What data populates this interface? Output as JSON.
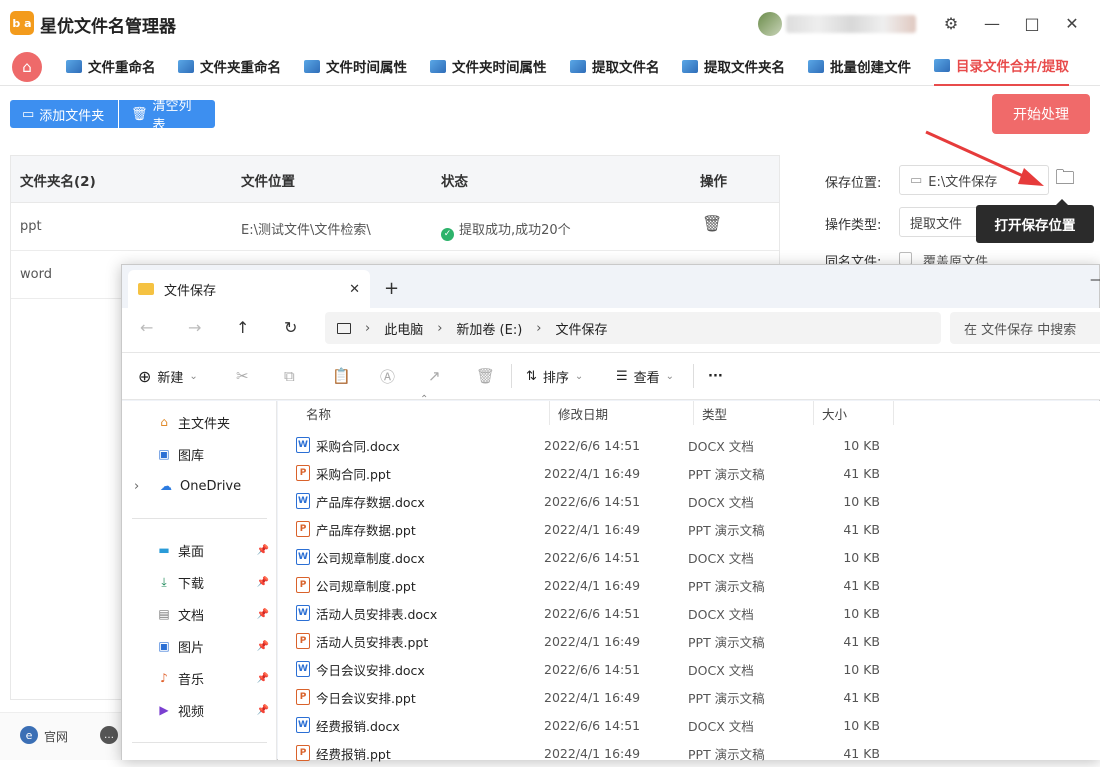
{
  "app": {
    "title": "星优文件名管理器",
    "logo": "b a"
  },
  "window_controls": {
    "settings": "⚙",
    "minimize": "—",
    "maximize": "□",
    "close": "✕"
  },
  "tabs": [
    {
      "label": "文件重命名"
    },
    {
      "label": "文件夹重命名"
    },
    {
      "label": "文件时间属性"
    },
    {
      "label": "文件夹时间属性"
    },
    {
      "label": "提取文件名"
    },
    {
      "label": "提取文件夹名"
    },
    {
      "label": "批量创建文件"
    },
    {
      "label": "目录文件合并/提取"
    }
  ],
  "toolbar": {
    "add_folder": "添加文件夹",
    "clear_list": "清空列表",
    "start": "开始处理"
  },
  "table": {
    "headers": [
      "文件夹名(2)",
      "文件位置",
      "状态",
      "操作"
    ],
    "rows": [
      {
        "name": "ppt",
        "location": "E:\\测试文件\\文件检索\\",
        "status": "提取成功,成功20个"
      },
      {
        "name": "word",
        "location": "",
        "status": ""
      }
    ]
  },
  "settings": {
    "save_label": "保存位置:",
    "save_value": "E:\\文件保存",
    "optype_label": "操作类型:",
    "optype_value": "提取文件",
    "dup_label": "同名文件:",
    "dup_value": "覆盖原文件",
    "tooltip": "打开保存位置"
  },
  "bottom": {
    "site": "官网"
  },
  "explorer": {
    "tab_title": "文件保存",
    "breadcrumb": [
      "此电脑",
      "新加卷 (E:)",
      "文件保存"
    ],
    "search_placeholder": "在 文件保存 中搜索",
    "commands": {
      "new": "新建",
      "sort": "排序",
      "view": "查看",
      "more": "···"
    },
    "nav": [
      {
        "label": "主文件夹",
        "icon": "home-icon"
      },
      {
        "label": "图库",
        "icon": "gallery-icon"
      },
      {
        "label": "OneDrive",
        "icon": "cloud-icon"
      },
      {
        "label": "桌面",
        "icon": "desktop-icon"
      },
      {
        "label": "下载",
        "icon": "download-icon"
      },
      {
        "label": "文档",
        "icon": "document-icon"
      },
      {
        "label": "图片",
        "icon": "picture-icon"
      },
      {
        "label": "音乐",
        "icon": "music-icon"
      },
      {
        "label": "视频",
        "icon": "video-icon"
      }
    ],
    "columns": [
      "名称",
      "修改日期",
      "类型",
      "大小"
    ],
    "files": [
      {
        "name": "采购合同.docx",
        "date": "2022/6/6 14:51",
        "type": "DOCX 文档",
        "size": "10 KB",
        "kind": "word"
      },
      {
        "name": "采购合同.ppt",
        "date": "2022/4/1 16:49",
        "type": "PPT 演示文稿",
        "size": "41 KB",
        "kind": "ppt"
      },
      {
        "name": "产品库存数据.docx",
        "date": "2022/6/6 14:51",
        "type": "DOCX 文档",
        "size": "10 KB",
        "kind": "word"
      },
      {
        "name": "产品库存数据.ppt",
        "date": "2022/4/1 16:49",
        "type": "PPT 演示文稿",
        "size": "41 KB",
        "kind": "ppt"
      },
      {
        "name": "公司规章制度.docx",
        "date": "2022/6/6 14:51",
        "type": "DOCX 文档",
        "size": "10 KB",
        "kind": "word"
      },
      {
        "name": "公司规章制度.ppt",
        "date": "2022/4/1 16:49",
        "type": "PPT 演示文稿",
        "size": "41 KB",
        "kind": "ppt"
      },
      {
        "name": "活动人员安排表.docx",
        "date": "2022/6/6 14:51",
        "type": "DOCX 文档",
        "size": "10 KB",
        "kind": "word"
      },
      {
        "name": "活动人员安排表.ppt",
        "date": "2022/4/1 16:49",
        "type": "PPT 演示文稿",
        "size": "41 KB",
        "kind": "ppt"
      },
      {
        "name": "今日会议安排.docx",
        "date": "2022/6/6 14:51",
        "type": "DOCX 文档",
        "size": "10 KB",
        "kind": "word"
      },
      {
        "name": "今日会议安排.ppt",
        "date": "2022/4/1 16:49",
        "type": "PPT 演示文稿",
        "size": "41 KB",
        "kind": "ppt"
      },
      {
        "name": "经费报销.docx",
        "date": "2022/6/6 14:51",
        "type": "DOCX 文档",
        "size": "10 KB",
        "kind": "word"
      },
      {
        "name": "经费报销.ppt",
        "date": "2022/4/1 16:49",
        "type": "PPT 演示文稿",
        "size": "41 KB",
        "kind": "ppt"
      }
    ]
  },
  "colors": {
    "accent": "#e84b4b",
    "primary": "#3d8ff0",
    "start": "#f06a6a",
    "success": "#2db36b"
  }
}
